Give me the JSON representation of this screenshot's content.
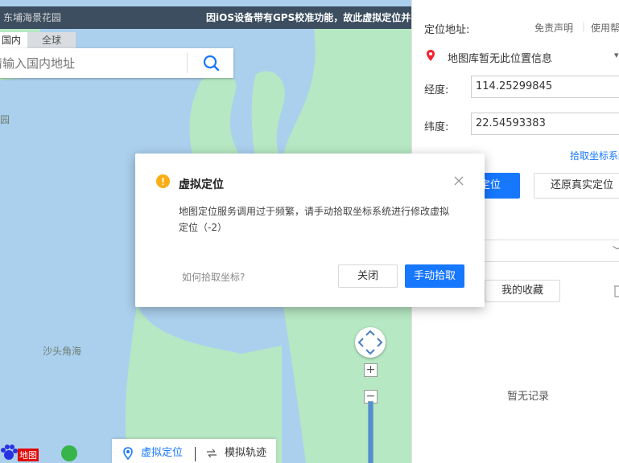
{
  "map": {
    "place_name": "东埔海景花园",
    "gps_notice": "因iOS设备带有GPS校准功能，故此虚拟定位并非",
    "tabs": [
      "国内",
      "全球"
    ],
    "search_placeholder": "请输入国内地址",
    "label_park": "园",
    "label_shatoujiao": "沙头角海",
    "zoom_plus": "+",
    "zoom_minus": "−",
    "bottom_bar": {
      "virtual_location": "虚拟定位",
      "simulate_track": "模拟轨迹"
    },
    "baidu_text": "地图"
  },
  "panel": {
    "location_address_label": "定位地址:",
    "disclaimer": "免责声明",
    "help": "使用帮",
    "location_info": "地图库暂无此位置信息",
    "longitude_label": "经度:",
    "longitude_value": "114.25299845",
    "latitude_label": "纬度:",
    "latitude_value": "22.54593383",
    "pick_coord_link": "拾取坐标系统",
    "confirm_btn": "定位",
    "restore_btn": "还原真实定位",
    "favorites_tab": "我的收藏",
    "empty_text": "暂无记录"
  },
  "dialog": {
    "title": "虚拟定位",
    "message": "地图定位服务调用过于频繁，请手动拾取坐标系统进行修改虚拟定位（-2）",
    "how_to_pick": "如何拾取坐标?",
    "close_btn": "关闭",
    "manual_pick_btn": "手动拾取"
  },
  "colors": {
    "primary": "#1677ff",
    "warning": "#faad14",
    "sea": "#abd0ee",
    "land": "#b6e8c3"
  }
}
